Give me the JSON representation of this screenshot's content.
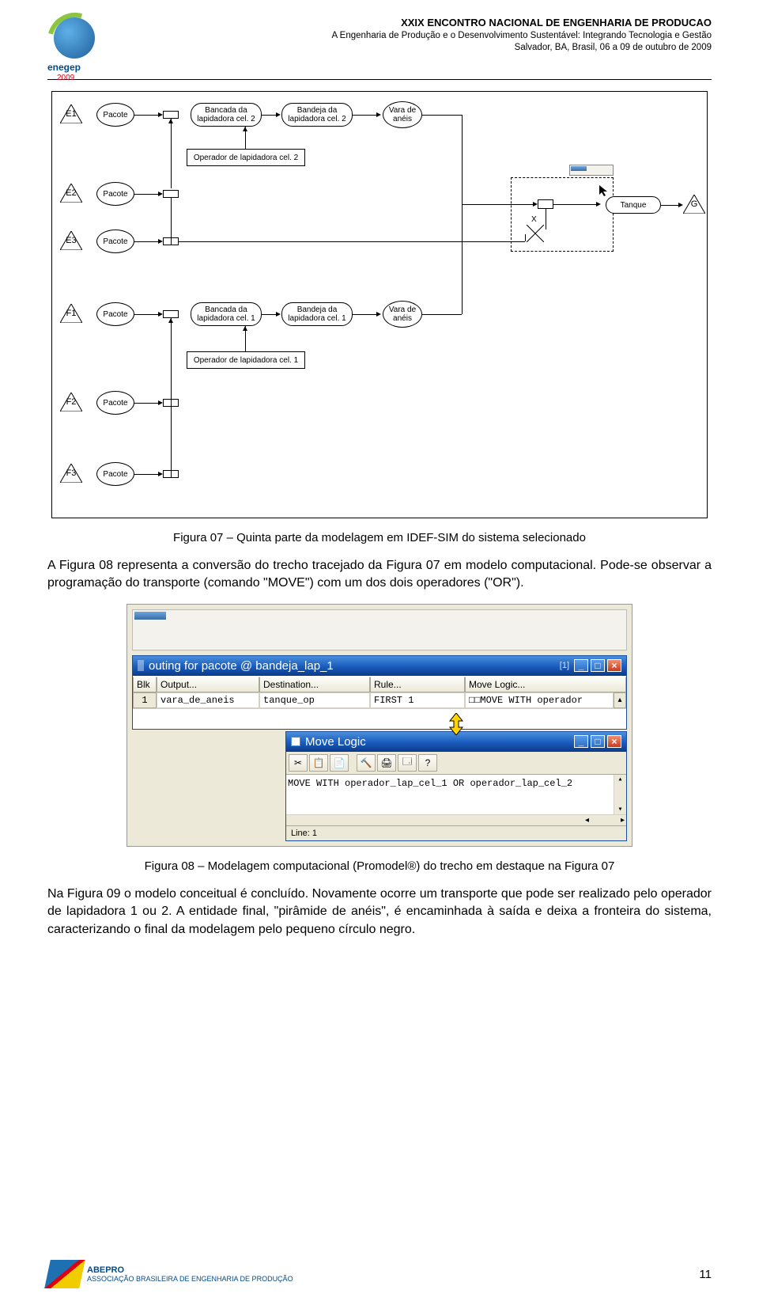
{
  "header": {
    "line1": "XXIX ENCONTRO NACIONAL DE ENGENHARIA DE PRODUCAO",
    "line2": "A Engenharia de Produção e o Desenvolvimento Sustentável:  Integrando Tecnologia e Gestão",
    "line3": "Salvador, BA, Brasil,  06 a 09 de outubro de 2009",
    "logo_text": "enegep",
    "logo_year": "2009"
  },
  "diagram": {
    "rows": {
      "E1": {
        "tri": "E1",
        "pkt": "Pacote",
        "bancada": "Bancada da lapidadora cel. 2",
        "bandeja": "Bandeja da lapidadora cel. 2",
        "vara": "Vara de anéis"
      },
      "E2": {
        "tri": "E2",
        "pkt": "Pacote"
      },
      "E3": {
        "tri": "E3",
        "pkt": "Pacote"
      },
      "F1": {
        "tri": "F1",
        "pkt": "Pacote",
        "bancada": "Bancada da lapidadora cel. 1",
        "bandeja": "Bandeja da lapidadora cel. 1",
        "vara": "Vara de anéis"
      },
      "F2": {
        "tri": "F2",
        "pkt": "Pacote"
      },
      "F3": {
        "tri": "F3",
        "pkt": "Pacote"
      }
    },
    "operator2": "Operador de lapidadora cel. 2",
    "operator1": "Operador de lapidadora cel. 1",
    "x": "X",
    "tanque": "Tanque",
    "G": "G"
  },
  "caption1": "Figura 07 – Quinta parte da modelagem em IDEF-SIM do sistema selecionado",
  "para1": "A Figura 08 representa a conversão do trecho tracejado da Figura 07 em modelo computacional. Pode-se observar a programação do transporte (comando \"MOVE\") com um dos dois operadores (\"OR\").",
  "shot": {
    "routing_title": "outing for pacote @ bandeja_lap_1",
    "sup": "[1]",
    "cols": {
      "c0": "Blk",
      "c1": "Output...",
      "c2": "Destination...",
      "c3": "Rule...",
      "c4": "Move Logic..."
    },
    "row": {
      "blk": "1",
      "out": "vara_de_aneis",
      "dest": "tanque_op",
      "rule": "FIRST 1",
      "logic": "□□MOVE WITH operador"
    },
    "move_title": "Move Logic",
    "toolbar": [
      "✂",
      "📋",
      "📄",
      "🔨",
      "🖨",
      "🗔",
      "?"
    ],
    "code": "MOVE WITH operador_lap_cel_1 OR operador_lap_cel_2",
    "status": "Line: 1"
  },
  "caption2": "Figura 08 – Modelagem computacional (Promodel®) do trecho em destaque na Figura 07",
  "para2": "Na Figura 09 o modelo conceitual é concluído. Novamente ocorre um transporte que pode ser realizado pelo operador de lapidadora 1 ou 2. A entidade final, \"pirâmide de anéis\", é encaminhada à saída e deixa a fronteira do sistema, caracterizando o final da modelagem pelo pequeno círculo negro.",
  "footer": {
    "brand": "ABEPRO",
    "sub": "ASSOCIAÇÃO BRASILEIRA DE ENGENHARIA DE PRODUÇÃO"
  },
  "page_number": "11"
}
